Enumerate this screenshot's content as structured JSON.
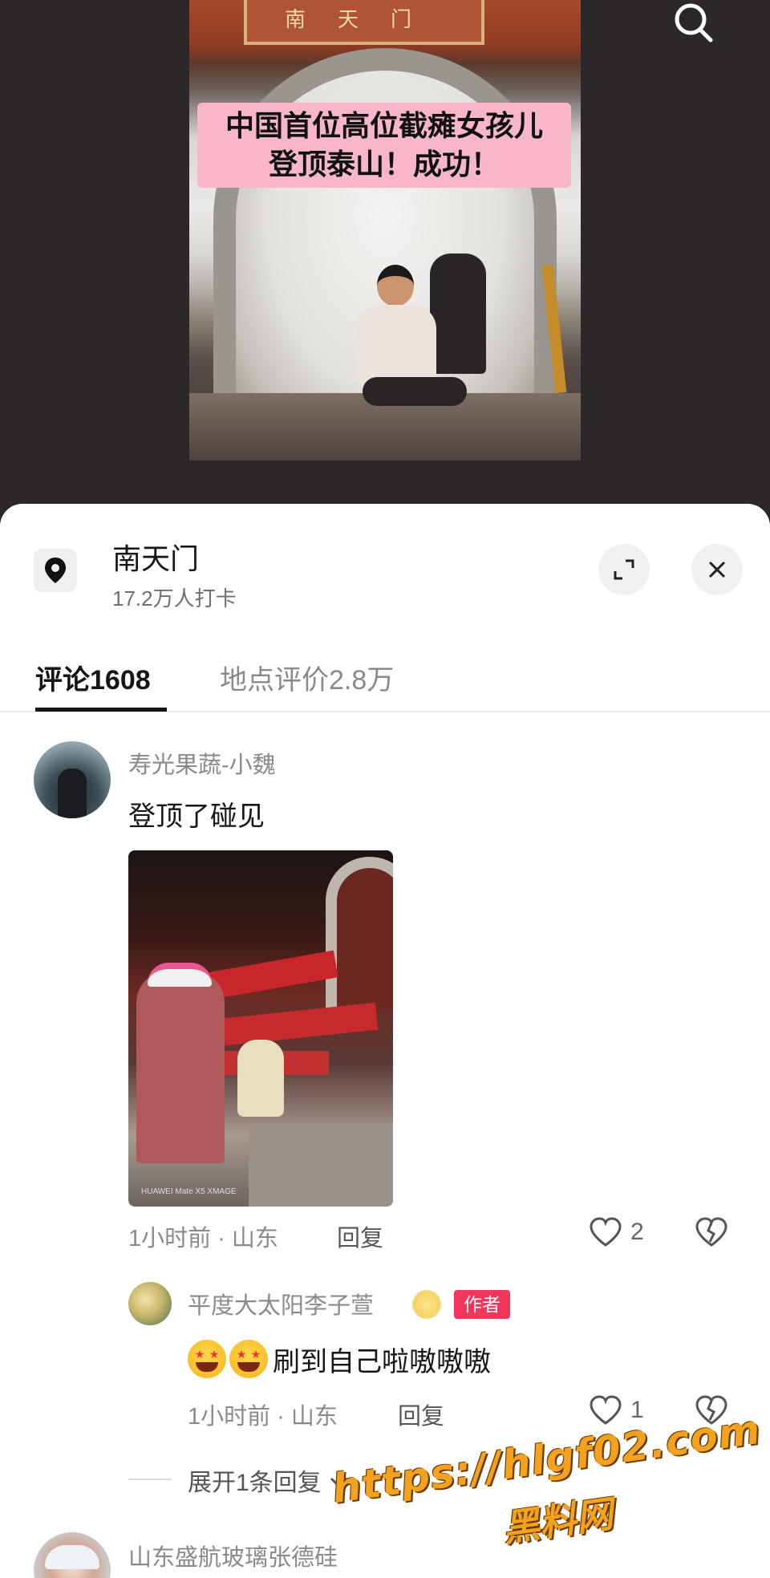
{
  "video": {
    "plaque_text": "南天门",
    "caption": "中国首位高位截瘫女孩儿\n登顶泰山！成功！",
    "search_icon": "search-icon"
  },
  "location": {
    "name": "南天门",
    "checkins": "17.2万人打卡",
    "pin_icon": "location-pin-icon"
  },
  "tabs": {
    "comments": "评论1608",
    "reviews": "地点评价2.8万"
  },
  "comments": [
    {
      "user": "寿光果蔬-小魏",
      "text": "登顶了碰见",
      "photo_watermark": "HUAWEI Mate X5 XMAGE",
      "time_location": "1小时前 · 山东",
      "reply_label": "回复",
      "likes": "2"
    }
  ],
  "replies": [
    {
      "user": "平度大太阳李子萱",
      "badge": "作者",
      "text": "刷到自己啦嗷嗷嗷",
      "time_location": "1小时前 · 山东",
      "reply_label": "回复",
      "likes": "1"
    }
  ],
  "expand_replies": "展开1条回复",
  "next_comment": {
    "user": "山东盛航玻璃张德硅"
  },
  "overlay": {
    "url": "https://hlgf02.com",
    "name": "黑料网"
  },
  "colors": {
    "badge": "#f2365b",
    "caption_bg": "#f7b7c9",
    "watermark": "#f2a21c"
  }
}
